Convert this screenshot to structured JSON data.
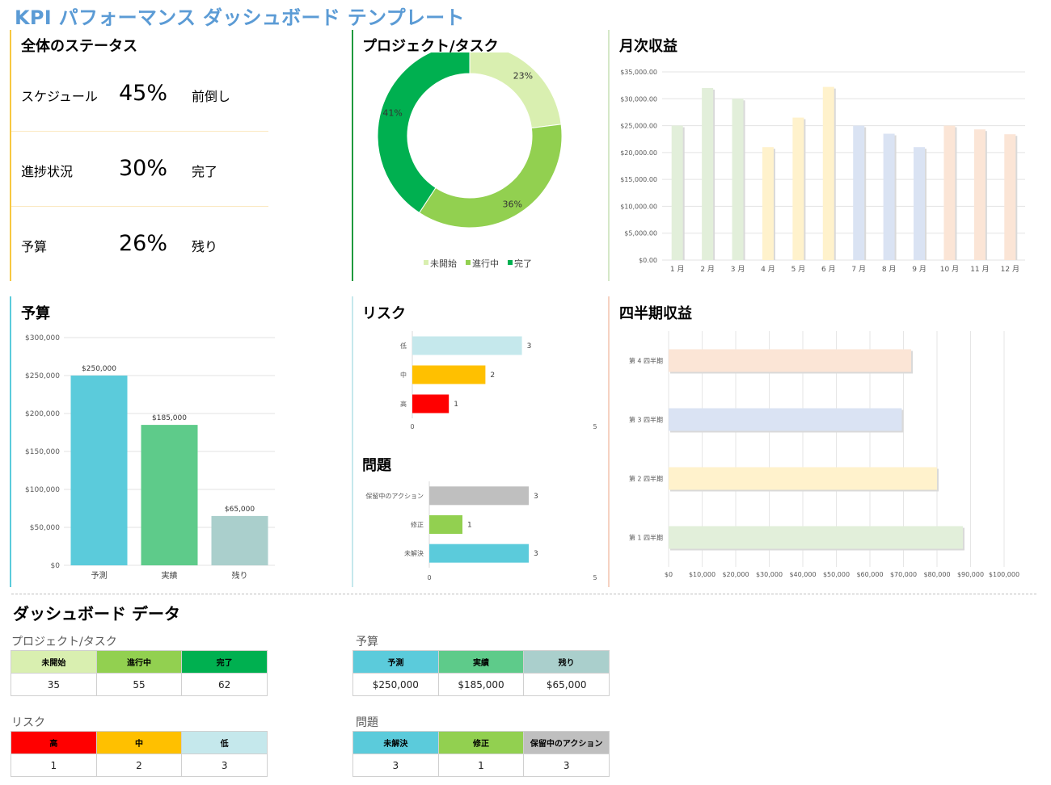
{
  "title": "KPI パフォーマンス ダッシュボード テンプレート",
  "overall_status": {
    "title": "全体のステータス",
    "rows": [
      {
        "label": "スケジュール",
        "value": "45%",
        "unit": "前倒し"
      },
      {
        "label": "進捗状況",
        "value": "30%",
        "unit": "完了"
      },
      {
        "label": "予算",
        "value": "26%",
        "unit": "残り"
      }
    ]
  },
  "colors": {
    "not_started": "#d9efb0",
    "in_progress": "#92d050",
    "complete": "#00b050",
    "forecast": "#5bcbdb",
    "actual": "#5ecb8a",
    "remaining": "#aacfcc",
    "high": "#ff0000",
    "medium": "#ffc000",
    "low": "#c5e8ec",
    "gray": "#bfbfbf",
    "status_line": "#f7c842",
    "project_line": "#1f9a3e",
    "revenue_line": "#d5e8c8",
    "budget_line": "#5bcbdb",
    "risk_line": "#c5e8ec",
    "quarter_line": "#f6d2c2"
  },
  "project_chart": {
    "title": "プロジェクト/タスク",
    "legend": [
      "未開始",
      "進行中",
      "完了"
    ],
    "chart_data": {
      "type": "pie",
      "categories": [
        "未開始",
        "進行中",
        "完了"
      ],
      "values": [
        35,
        55,
        62
      ],
      "labels": [
        "23%",
        "36%",
        "41%"
      ]
    }
  },
  "monthly_revenue": {
    "title": "月次収益",
    "chart_data": {
      "type": "bar",
      "categories": [
        "1 月",
        "2 月",
        "3 月",
        "4 月",
        "5 月",
        "6 月",
        "7 月",
        "8 月",
        "9 月",
        "10 月",
        "11 月",
        "12 月"
      ],
      "values": [
        25000,
        32000,
        30000,
        21000,
        26500,
        32200,
        25000,
        23500,
        21000,
        25000,
        24300,
        23400
      ],
      "colors": [
        "#e2efda",
        "#e2efda",
        "#e2efda",
        "#fff2cc",
        "#fff2cc",
        "#fff2cc",
        "#dae3f3",
        "#dae3f3",
        "#dae3f3",
        "#fbe5d6",
        "#fbe5d6",
        "#fbe5d6"
      ],
      "yticks": [
        "$0.00",
        "$5,000.00",
        "$10,000.00",
        "$15,000.00",
        "$20,000.00",
        "$25,000.00",
        "$30,000.00",
        "$35,000.00"
      ],
      "ylim": [
        0,
        35000
      ]
    }
  },
  "budget_chart": {
    "title": "予算",
    "chart_data": {
      "type": "bar",
      "categories": [
        "予測",
        "実績",
        "残り"
      ],
      "values": [
        250000,
        185000,
        65000
      ],
      "data_labels": [
        "$250,000",
        "$185,000",
        "$65,000"
      ],
      "yticks": [
        "$0",
        "$50,000",
        "$100,000",
        "$150,000",
        "$200,000",
        "$250,000",
        "$300,000"
      ],
      "ylim": [
        0,
        300000
      ]
    }
  },
  "risk_chart": {
    "title": "リスク",
    "chart_data": {
      "type": "bar",
      "orientation": "horizontal",
      "categories": [
        "低",
        "中",
        "高"
      ],
      "values": [
        3,
        2,
        1
      ],
      "xticks": [
        "0",
        "5"
      ],
      "xlim": [
        0,
        5
      ]
    }
  },
  "issues_chart": {
    "title": "問題",
    "chart_data": {
      "type": "bar",
      "orientation": "horizontal",
      "categories": [
        "保留中のアクション",
        "修正",
        "未解決"
      ],
      "values": [
        3,
        1,
        3
      ],
      "xticks": [
        "0",
        "5"
      ],
      "xlim": [
        0,
        5
      ]
    }
  },
  "quarterly_revenue": {
    "title": "四半期収益",
    "chart_data": {
      "type": "bar",
      "orientation": "horizontal",
      "categories": [
        "第 4 四半期",
        "第 3 四半期",
        "第 2 四半期",
        "第 1 四半期"
      ],
      "values": [
        72300,
        69500,
        80000,
        87700
      ],
      "colors": [
        "#fbe5d6",
        "#dae3f3",
        "#fff2cc",
        "#e2efda"
      ],
      "xticks": [
        "$0",
        "$10,000",
        "$20,000",
        "$30,000",
        "$40,000",
        "$50,000",
        "$60,000",
        "$70,000",
        "$80,000",
        "$90,000",
        "$100,000"
      ],
      "xlim": [
        0,
        100000
      ]
    }
  },
  "dashboard_data": {
    "title": "ダッシュボード データ",
    "project_table": {
      "caption": "プロジェクト/タスク",
      "headers": [
        "未開始",
        "進行中",
        "完了"
      ],
      "values": [
        "35",
        "55",
        "62"
      ]
    },
    "budget_table": {
      "caption": "予算",
      "headers": [
        "予測",
        "実績",
        "残り"
      ],
      "values": [
        "$250,000",
        "$185,000",
        "$65,000"
      ]
    },
    "risk_table": {
      "caption": "リスク",
      "headers": [
        "高",
        "中",
        "低"
      ],
      "values": [
        "1",
        "2",
        "3"
      ]
    },
    "issues_table": {
      "caption": "問題",
      "headers": [
        "未解決",
        "修正",
        "保留中のアクション"
      ],
      "values": [
        "3",
        "1",
        "3"
      ]
    }
  }
}
